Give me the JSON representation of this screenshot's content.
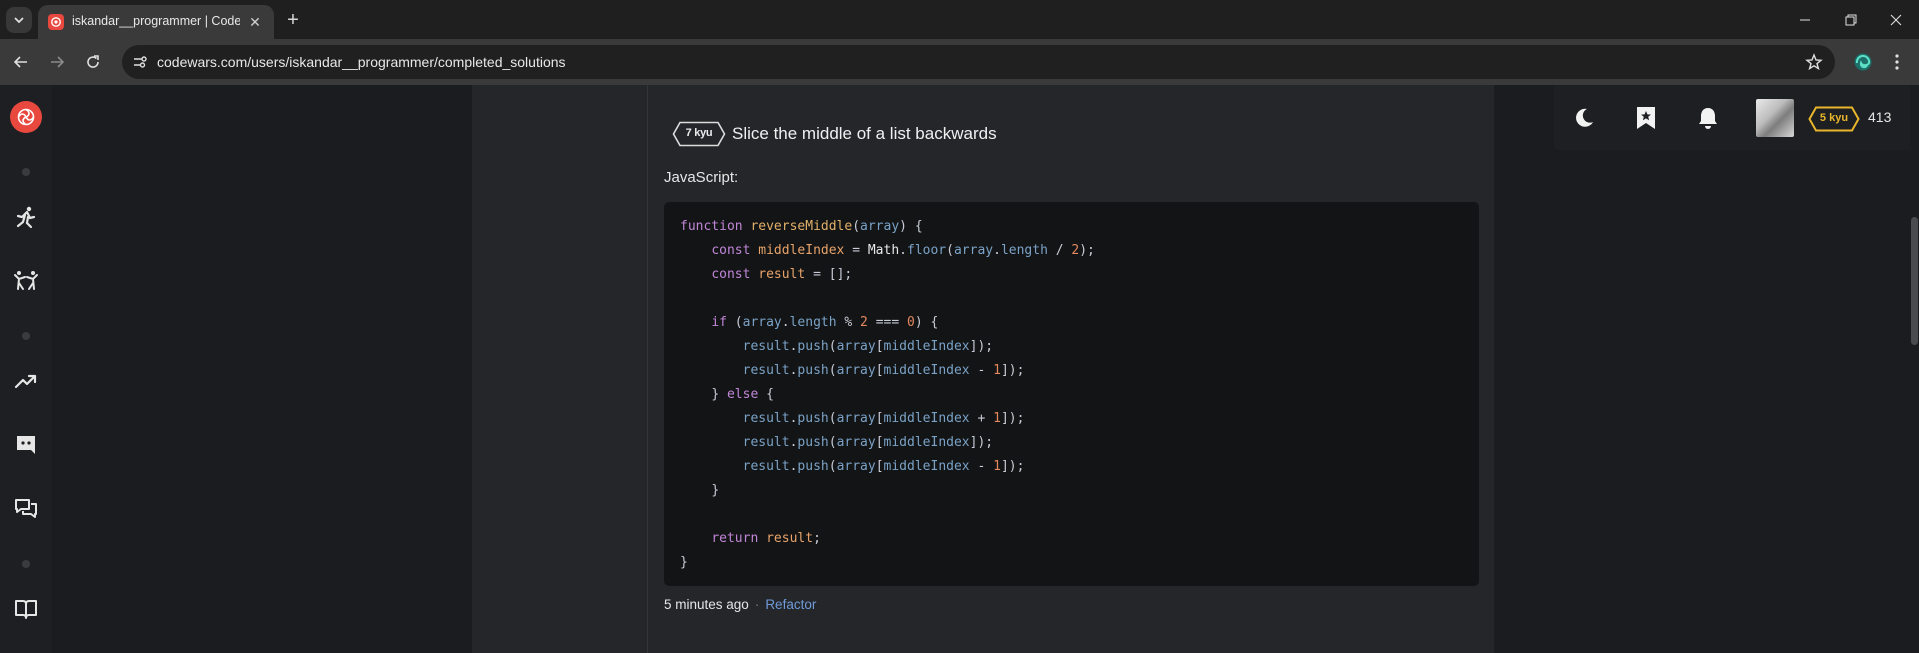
{
  "browser": {
    "tab_title": "iskandar__programmer | Codew",
    "url": "codewars.com/users/iskandar__programmer/completed_solutions",
    "tab_close_glyph": "✕",
    "new_tab_glyph": "+"
  },
  "sidebar": {
    "icons": [
      "codewars-logo-icon",
      "training-icon",
      "practice-icon",
      "leaderboards-icon",
      "discord-icon",
      "forum-icon",
      "docs-icon"
    ]
  },
  "userbar": {
    "rank": "5 kyu",
    "honor": "413"
  },
  "kata": {
    "rank": "7 kyu",
    "name": "Slice the middle of a list backwards",
    "language": "JavaScript:"
  },
  "solution": {
    "code_lines": [
      "function reverseMiddle(array) {",
      "    const middleIndex = Math.floor(array.length / 2);",
      "    const result = [];",
      "",
      "    if (array.length % 2 === 0) {",
      "        result.push(array[middleIndex]);",
      "        result.push(array[middleIndex - 1]);",
      "    } else {",
      "        result.push(array[middleIndex + 1]);",
      "        result.push(array[middleIndex]);",
      "        result.push(array[middleIndex - 1]);",
      "    }",
      "",
      "    return result;",
      "}"
    ],
    "time": "5 minutes ago",
    "separator": "·",
    "refactor_label": "Refactor"
  },
  "colors": {
    "brand": "#e9483f",
    "rank_badge_gold": "#e8b52c",
    "link": "#6f9ad8"
  }
}
